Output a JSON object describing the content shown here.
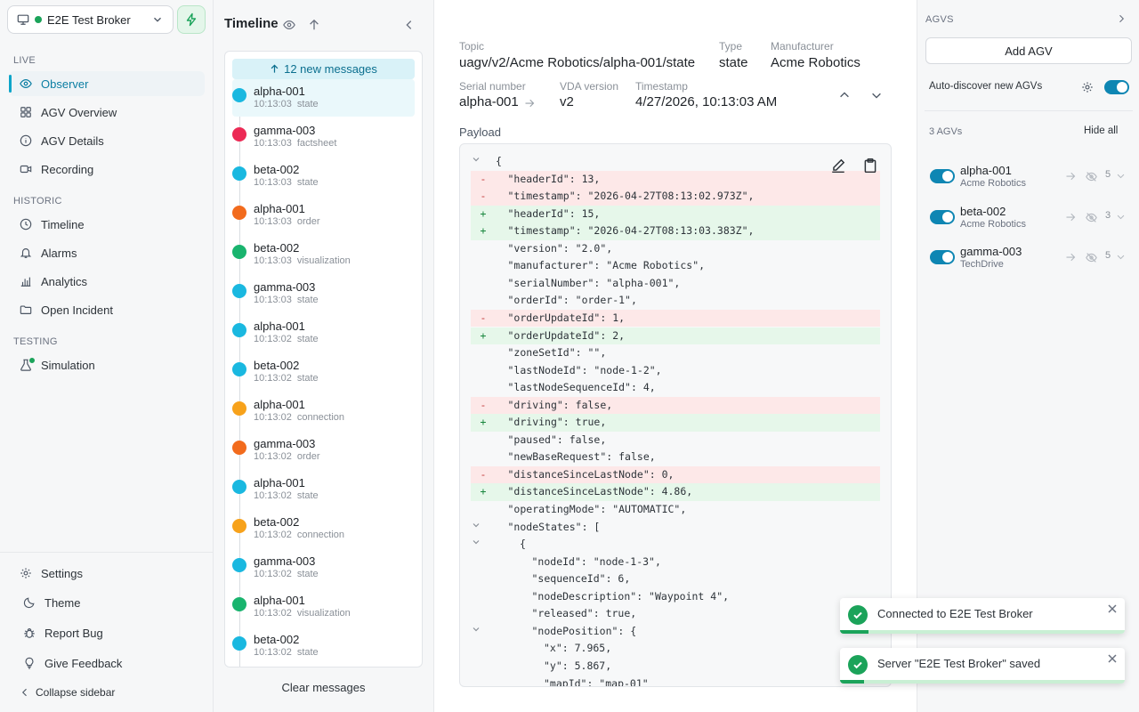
{
  "sidebar": {
    "broker": {
      "name": "E2E Test Broker"
    },
    "sections": {
      "live": "LIVE",
      "historic": "HISTORIC",
      "testing": "TESTING"
    },
    "items": {
      "observer": "Observer",
      "agv_overview": "AGV Overview",
      "agv_details": "AGV Details",
      "recording": "Recording",
      "timeline": "Timeline",
      "alarms": "Alarms",
      "analytics": "Analytics",
      "open_incident": "Open Incident",
      "simulation": "Simulation"
    },
    "footer": {
      "settings": "Settings",
      "theme": "Theme",
      "report_bug": "Report Bug",
      "give_feedback": "Give Feedback",
      "collapse": "Collapse sidebar"
    }
  },
  "timeline": {
    "title": "Timeline",
    "new_messages": "12 new messages",
    "clear": "Clear messages",
    "items": [
      {
        "name": "alpha-001",
        "time": "10:13:03",
        "type": "state",
        "color": "#1ab8e0"
      },
      {
        "name": "gamma-003",
        "time": "10:13:03",
        "type": "factsheet",
        "color": "#ec2a55"
      },
      {
        "name": "beta-002",
        "time": "10:13:03",
        "type": "state",
        "color": "#1ab8e0"
      },
      {
        "name": "alpha-001",
        "time": "10:13:03",
        "type": "order",
        "color": "#f26b1d"
      },
      {
        "name": "beta-002",
        "time": "10:13:03",
        "type": "visualization",
        "color": "#19b46e"
      },
      {
        "name": "gamma-003",
        "time": "10:13:03",
        "type": "state",
        "color": "#1ab8e0"
      },
      {
        "name": "alpha-001",
        "time": "10:13:02",
        "type": "state",
        "color": "#1ab8e0"
      },
      {
        "name": "beta-002",
        "time": "10:13:02",
        "type": "state",
        "color": "#1ab8e0"
      },
      {
        "name": "alpha-001",
        "time": "10:13:02",
        "type": "connection",
        "color": "#f7a21b"
      },
      {
        "name": "gamma-003",
        "time": "10:13:02",
        "type": "order",
        "color": "#f26b1d"
      },
      {
        "name": "alpha-001",
        "time": "10:13:02",
        "type": "state",
        "color": "#1ab8e0"
      },
      {
        "name": "beta-002",
        "time": "10:13:02",
        "type": "connection",
        "color": "#f7a21b"
      },
      {
        "name": "gamma-003",
        "time": "10:13:02",
        "type": "state",
        "color": "#1ab8e0"
      },
      {
        "name": "alpha-001",
        "time": "10:13:02",
        "type": "visualization",
        "color": "#19b46e"
      },
      {
        "name": "beta-002",
        "time": "10:13:02",
        "type": "state",
        "color": "#1ab8e0"
      }
    ]
  },
  "detail": {
    "topic_label": "Topic",
    "topic": "uagv/v2/Acme Robotics/alpha-001/state",
    "type_label": "Type",
    "type": "state",
    "manufacturer_label": "Manufacturer",
    "manufacturer": "Acme Robotics",
    "serial_label": "Serial number",
    "serial": "alpha-001",
    "vda_label": "VDA version",
    "vda": "v2",
    "timestamp_label": "Timestamp",
    "timestamp": "4/27/2026, 10:13:03 AM",
    "payload_label": "Payload",
    "payload_lines": [
      {
        "d": "",
        "t": "{",
        "fold": true,
        "ind": 0
      },
      {
        "d": "rem",
        "t": "\"headerId\": 13,",
        "ind": 1
      },
      {
        "d": "rem",
        "t": "\"timestamp\": \"2026-04-27T08:13:02.973Z\",",
        "ind": 1
      },
      {
        "d": "add",
        "t": "\"headerId\": 15,",
        "ind": 1
      },
      {
        "d": "add",
        "t": "\"timestamp\": \"2026-04-27T08:13:03.383Z\",",
        "ind": 1
      },
      {
        "d": "",
        "t": "\"version\": \"2.0\",",
        "ind": 1
      },
      {
        "d": "",
        "t": "\"manufacturer\": \"Acme Robotics\",",
        "ind": 1
      },
      {
        "d": "",
        "t": "\"serialNumber\": \"alpha-001\",",
        "ind": 1
      },
      {
        "d": "",
        "t": "\"orderId\": \"order-1\",",
        "ind": 1
      },
      {
        "d": "rem",
        "t": "\"orderUpdateId\": 1,",
        "ind": 1
      },
      {
        "d": "add",
        "t": "\"orderUpdateId\": 2,",
        "ind": 1
      },
      {
        "d": "",
        "t": "\"zoneSetId\": \"\",",
        "ind": 1
      },
      {
        "d": "",
        "t": "\"lastNodeId\": \"node-1-2\",",
        "ind": 1
      },
      {
        "d": "",
        "t": "\"lastNodeSequenceId\": 4,",
        "ind": 1
      },
      {
        "d": "rem",
        "t": "\"driving\": false,",
        "ind": 1
      },
      {
        "d": "add",
        "t": "\"driving\": true,",
        "ind": 1
      },
      {
        "d": "",
        "t": "\"paused\": false,",
        "ind": 1
      },
      {
        "d": "",
        "t": "\"newBaseRequest\": false,",
        "ind": 1
      },
      {
        "d": "rem",
        "t": "\"distanceSinceLastNode\": 0,",
        "ind": 1
      },
      {
        "d": "add",
        "t": "\"distanceSinceLastNode\": 4.86,",
        "ind": 1
      },
      {
        "d": "",
        "t": "\"operatingMode\": \"AUTOMATIC\",",
        "ind": 1
      },
      {
        "d": "",
        "t": "\"nodeStates\": [",
        "fold": true,
        "ind": 1
      },
      {
        "d": "",
        "t": "{",
        "fold": true,
        "ind": 2
      },
      {
        "d": "",
        "t": "\"nodeId\": \"node-1-3\",",
        "ind": 3
      },
      {
        "d": "",
        "t": "\"sequenceId\": 6,",
        "ind": 3
      },
      {
        "d": "",
        "t": "\"nodeDescription\": \"Waypoint 4\",",
        "ind": 3
      },
      {
        "d": "",
        "t": "\"released\": true,",
        "ind": 3
      },
      {
        "d": "",
        "t": "\"nodePosition\": {",
        "fold": true,
        "ind": 3
      },
      {
        "d": "",
        "t": "\"x\": 7.965,",
        "ind": 4
      },
      {
        "d": "",
        "t": "\"y\": 5.867,",
        "ind": 4
      },
      {
        "d": "",
        "t": "\"mapId\": \"map-01\"",
        "ind": 4
      }
    ]
  },
  "agvs": {
    "title": "AGVS",
    "add_label": "Add AGV",
    "auto_discover": "Auto-discover new AGVs",
    "count_label": "3 AGVs",
    "hide_all": "Hide all",
    "items": [
      {
        "name": "alpha-001",
        "manufacturer": "Acme Robotics",
        "count": "5"
      },
      {
        "name": "beta-002",
        "manufacturer": "Acme Robotics",
        "count": "3"
      },
      {
        "name": "gamma-003",
        "manufacturer": "TechDrive",
        "count": "5"
      }
    ]
  },
  "toasts": [
    {
      "message": "Connected to E2E Test Broker",
      "progress": 0.1
    },
    {
      "message": "Server \"E2E Test Broker\" saved",
      "progress": 0.085
    }
  ],
  "colors": {
    "accent": "#0ea5c9",
    "success": "#1ba35a",
    "removed": "#fde8e8",
    "added": "#e6f7ea"
  }
}
